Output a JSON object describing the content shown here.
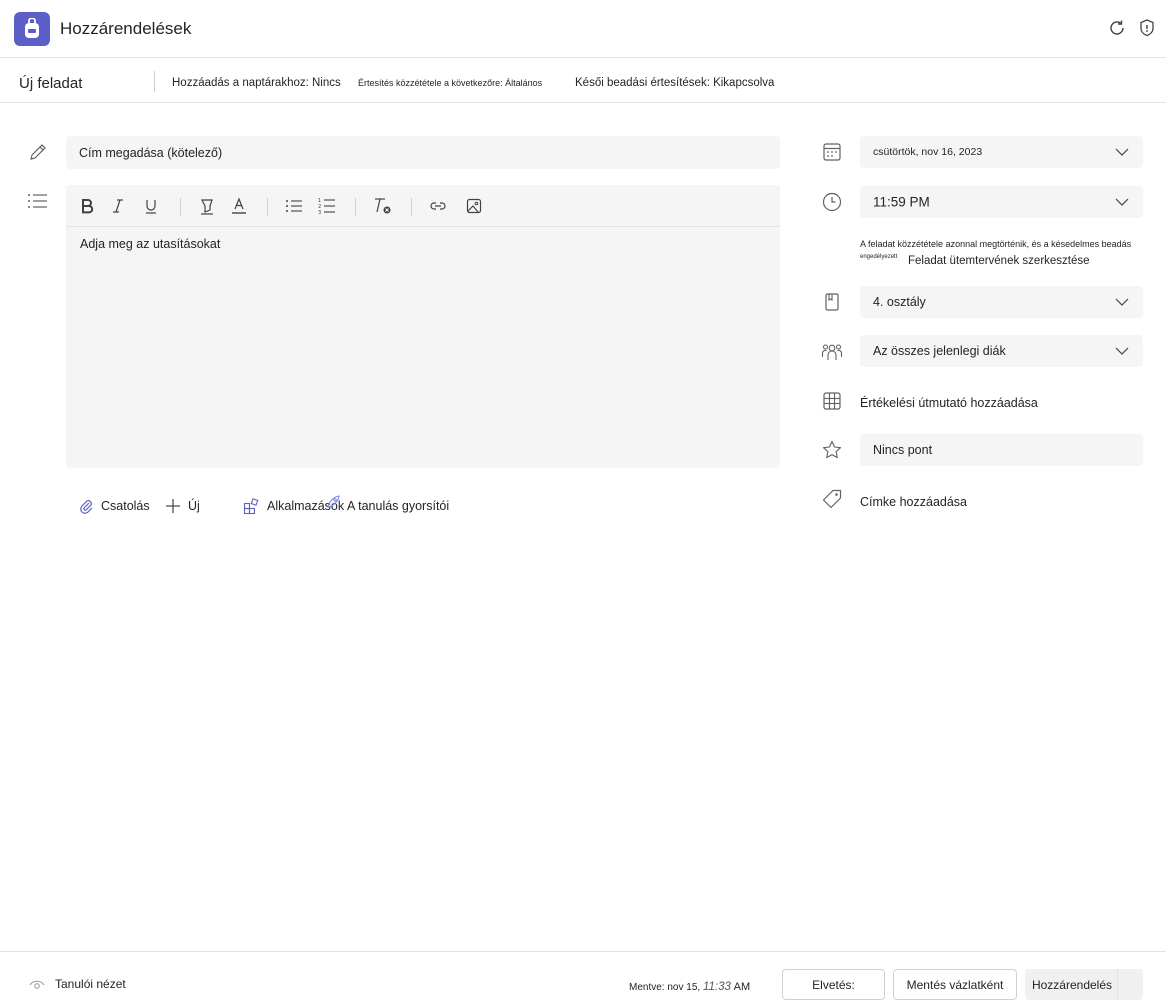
{
  "header": {
    "app_title": "Hozzárendelések",
    "icons": [
      "backpack-icon",
      "refresh-icon",
      "shield-icon"
    ],
    "brand_color": "#5b5fc7"
  },
  "subbar": {
    "title": "Új feladat",
    "calendar_setting": "Hozzáadás a naptárakhoz: Nincs",
    "notify_setting": "Értesítés közzététele a következőre: Általános",
    "late_setting": "Késői beadási értesítések: Kikapcsolva"
  },
  "form": {
    "title_placeholder": "Cím megadása (kötelező)",
    "instructions_placeholder": "Adja meg az utasításokat",
    "toolbar_icons": [
      "bold-icon",
      "italic-icon",
      "underline-icon",
      "highlight-icon",
      "font-color-icon",
      "bullet-list-icon",
      "numbered-list-icon",
      "clear-format-icon",
      "link-icon",
      "image-icon"
    ]
  },
  "attach_bar": {
    "attach": "Csatolás",
    "new": "Új",
    "apps": "Alkalmazások",
    "learning_accelerators": "A tanulás gyorsítói"
  },
  "right_panel": {
    "due_date": "csütörtök, nov 16, 2023",
    "due_time": "11:59 PM",
    "schedule_note": "A feladat közzététele azonnal megtörténik, és a késedelmes beadás",
    "schedule_note_small": "engedélyezett",
    "schedule_link": "Feladat ütemtervének szerkesztése",
    "class": "4. osztály",
    "students": "Az összes jelenlegi diák",
    "rubric": "Értékelési útmutató hozzáadása",
    "points": "Nincs pont",
    "tag": "Címke hozzáadása"
  },
  "footer": {
    "student_view": "Tanulói nézet",
    "saved_label": "Mentve: nov 15,",
    "saved_time": "11:33",
    "saved_ampm": "AM",
    "discard": "Elvetés:",
    "save_draft": "Mentés vázlatként",
    "assign": "Hozzárendelés"
  }
}
